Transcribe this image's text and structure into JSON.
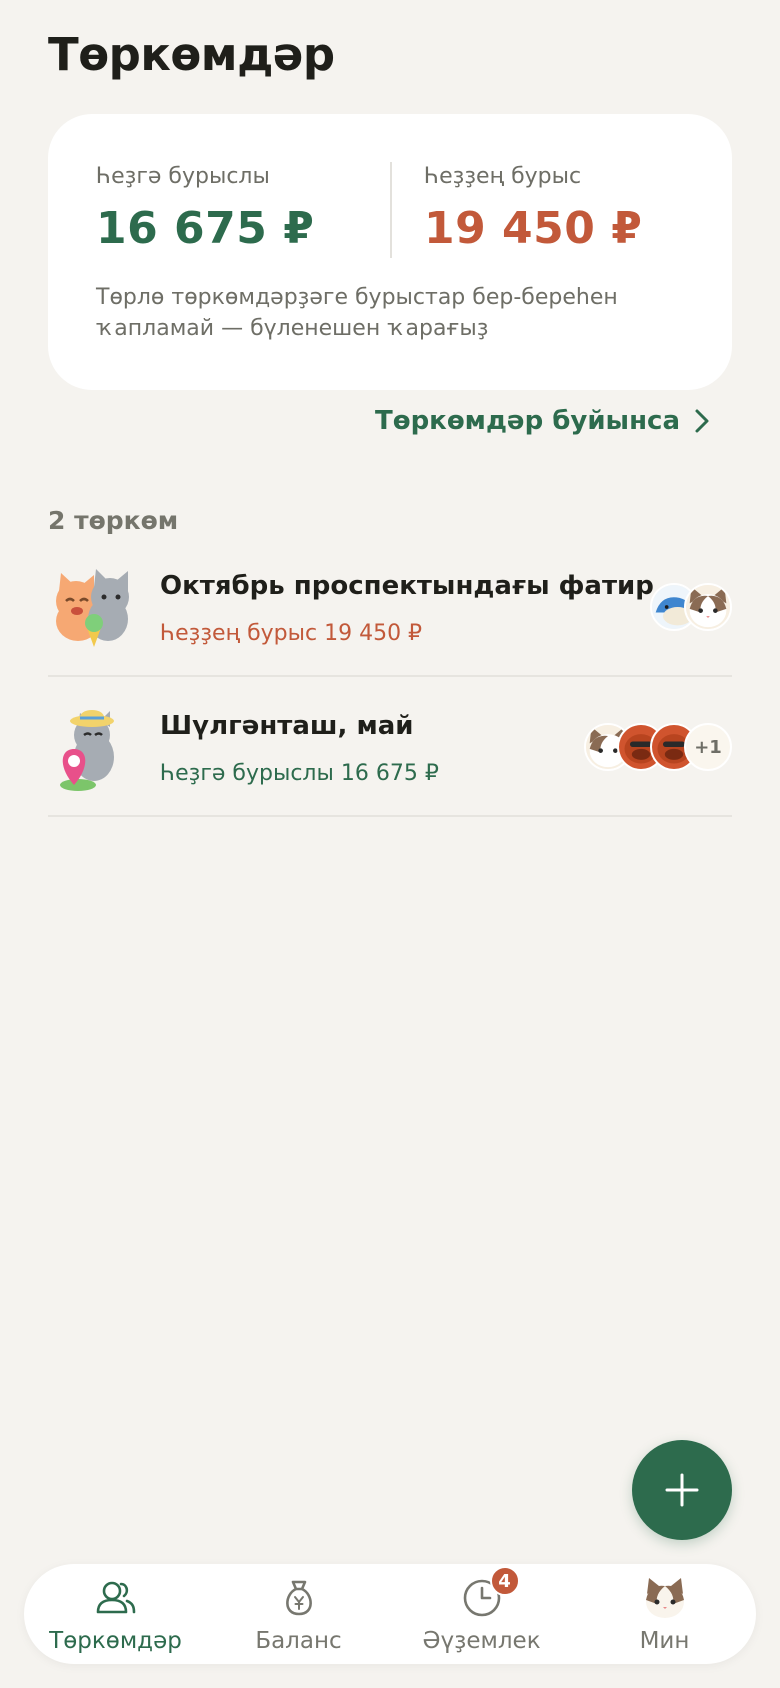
{
  "page": {
    "title": "Төркөмдәр"
  },
  "summary": {
    "owed_to_you_label": "Һеҙгә бурыслы",
    "owed_to_you_amount": "16 675 ₽",
    "you_owe_label": "Һеҙҙең бурыс",
    "you_owe_amount": "19 450 ₽",
    "note": "Төрлө төркөмдәрҙәге бурыстар бер-береһен ҡапламай — бүленешен ҡарағыҙ"
  },
  "by_groups_link": {
    "label": "Төркөмдәр буйынса"
  },
  "groups_section": {
    "heading": "2 төркөм",
    "items": [
      {
        "name": "Октябрь проспектындағы фатир",
        "balance": "Һеҙҙең бурыс 19 450 ₽",
        "balance_status": "owe"
      },
      {
        "name": "Шүлгәнташ, май",
        "balance": "Һеҙгә бурыслы 16 675 ₽",
        "balance_status": "owed",
        "extra_members": "+1"
      }
    ]
  },
  "fab": {
    "icon": "plus-icon"
  },
  "tabbar": {
    "tabs": [
      {
        "label": "Төркөмдәр",
        "icon": "people-icon",
        "active": true
      },
      {
        "label": "Баланс",
        "icon": "money-bag-icon",
        "active": false
      },
      {
        "label": "Әүҙемлек",
        "icon": "clock-icon",
        "active": false,
        "badge": "4"
      },
      {
        "label": "Мин",
        "icon": "cat-avatar-icon",
        "active": false
      }
    ]
  },
  "colors": {
    "background": "#f5f3ef",
    "accent_green": "#2d6b4d",
    "accent_red": "#c2593a",
    "card": "#ffffff"
  }
}
